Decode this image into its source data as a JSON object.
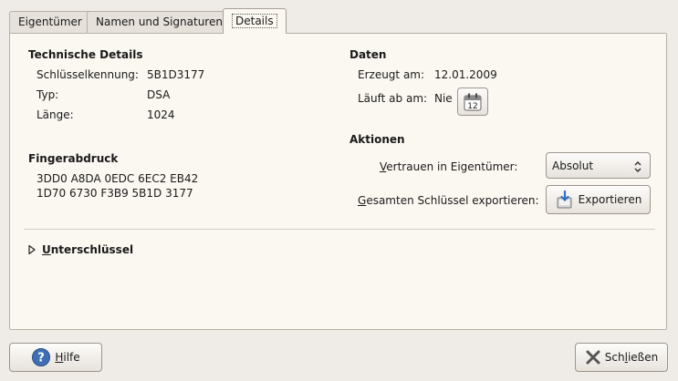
{
  "tabs": [
    {
      "label": "Eigentümer"
    },
    {
      "label": "Namen und Signaturen"
    },
    {
      "label": "Details"
    }
  ],
  "technical": {
    "heading": "Technische Details",
    "key_id_label": "Schlüsselkennung:",
    "key_id_value": "5B1D3177",
    "type_label": "Typ:",
    "type_value": "DSA",
    "length_label": "Länge:",
    "length_value": "1024"
  },
  "fingerprint": {
    "heading": "Fingerabdruck",
    "line1": "3DD0 A8DA 0EDC 6EC2 EB42",
    "line2": "1D70 6730 F3B9 5B1D 3177"
  },
  "dates": {
    "heading": "Daten",
    "created_label": "Erzeugt am:",
    "created_value": "12.01.2009",
    "expires_label": "Läuft ab am:",
    "expires_value": "Nie",
    "calendar_day": "12"
  },
  "actions": {
    "heading": "Aktionen",
    "trust_label_first": "V",
    "trust_label_rest": "ertrauen in Eigentümer:",
    "trust_value": "Absolut",
    "export_label_first": "G",
    "export_label_rest": "esamten Schlüssel exportieren:",
    "export_button": "Exportieren"
  },
  "subkeys": {
    "label_first": "U",
    "label_rest": "nterschlüssel"
  },
  "footer": {
    "help_first": "H",
    "help_rest": "ilfe",
    "close_before": "Sch",
    "close_mnemonic": "l",
    "close_after": "ießen"
  },
  "colors": {
    "window_bg": "#efebe7",
    "panel_bg": "#fbf8f1",
    "help_icon": "#3f6fb3",
    "close_icon": "#555555"
  }
}
